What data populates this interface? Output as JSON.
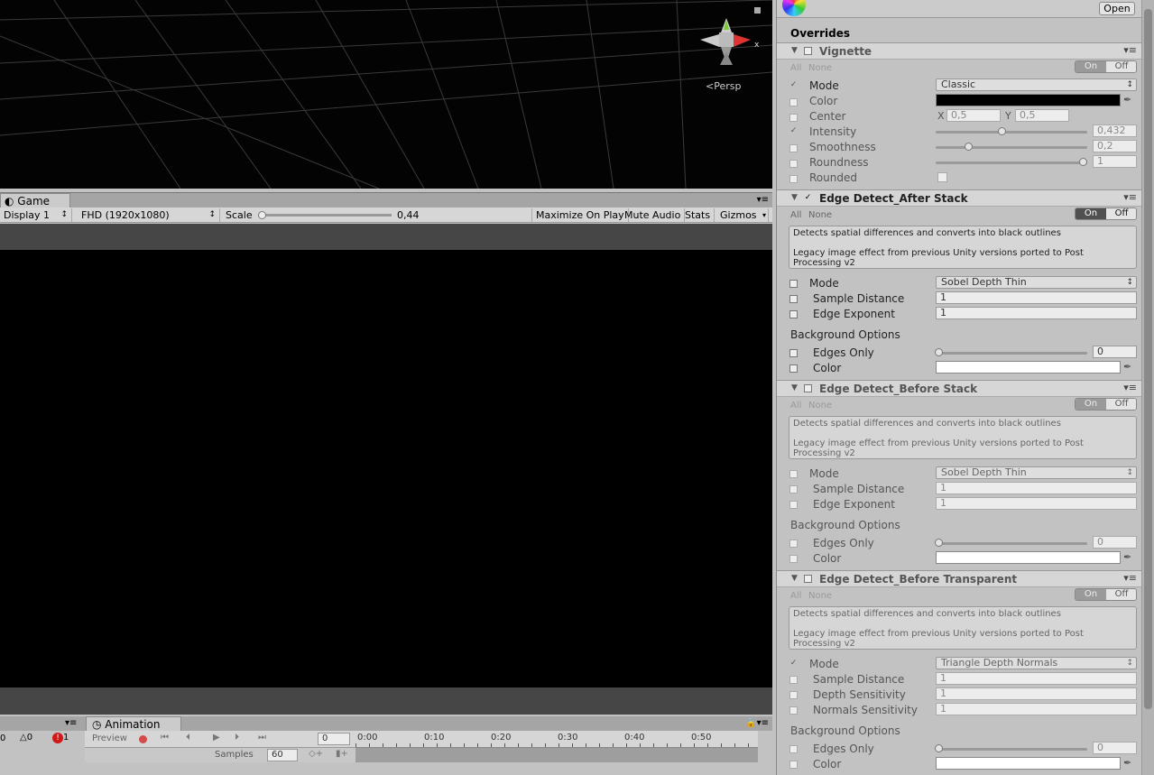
{
  "scene": {
    "persp_label": "Persp",
    "gizmo_axis": "x"
  },
  "game": {
    "tab_label": "Game",
    "display": "Display 1",
    "resolution": "FHD (1920x1080)",
    "scale_label": "Scale",
    "scale_value": "0,44",
    "scale_fraction": 0.0,
    "maximize": "Maximize On Play",
    "mute": "Mute Audio",
    "stats": "Stats",
    "gizmos": "Gizmos"
  },
  "console": {
    "info_count": "0",
    "warn_count": "0",
    "error_count": "1"
  },
  "animation": {
    "tab_label": "Animation",
    "preview": "Preview",
    "frame": "0",
    "samples_label": "Samples",
    "samples": "60",
    "ticks": [
      "0:00",
      "0:10",
      "0:20",
      "0:30",
      "0:40",
      "0:50"
    ]
  },
  "inspector": {
    "open_button": "Open",
    "overrides_title": "Overrides",
    "all": "All",
    "none": "None",
    "on": "On",
    "off": "Off",
    "vignette": {
      "name": "Vignette",
      "mode_label": "Mode",
      "mode_value": "Classic",
      "color_label": "Color",
      "center_label": "Center",
      "center_x_label": "X",
      "center_x": "0,5",
      "center_y_label": "Y",
      "center_y": "0,5",
      "intensity_label": "Intensity",
      "intensity": "0,432",
      "intensity_fraction": 0.432,
      "smoothness_label": "Smoothness",
      "smoothness": "0,2",
      "smoothness_fraction": 0.2,
      "roundness_label": "Roundness",
      "roundness": "1",
      "roundness_fraction": 1.0,
      "rounded_label": "Rounded"
    },
    "after_stack": {
      "name": "Edge Detect_After Stack",
      "desc1": "Detects spatial differences and converts into black outlines",
      "desc2": "Legacy image effect from previous Unity versions ported to Post Processing v2",
      "mode_label": "Mode",
      "mode_value": "Sobel Depth Thin",
      "sample_distance_label": "Sample Distance",
      "sample_distance": "1",
      "edge_exponent_label": "Edge Exponent",
      "edge_exponent": "1",
      "bg_options": "Background Options",
      "edges_only_label": "Edges Only",
      "edges_only": "0",
      "color_label": "Color"
    },
    "before_stack": {
      "name": "Edge Detect_Before Stack",
      "desc1": "Detects spatial differences and converts into black outlines",
      "desc2": "Legacy image effect from previous Unity versions ported to Post Processing v2",
      "mode_label": "Mode",
      "mode_value": "Sobel Depth Thin",
      "sample_distance_label": "Sample Distance",
      "sample_distance": "1",
      "edge_exponent_label": "Edge Exponent",
      "edge_exponent": "1",
      "bg_options": "Background Options",
      "edges_only_label": "Edges Only",
      "edges_only": "0",
      "color_label": "Color"
    },
    "before_transparent": {
      "name": "Edge Detect_Before Transparent",
      "desc1": "Detects spatial differences and converts into black outlines",
      "desc2": "Legacy image effect from previous Unity versions ported to Post Processing v2",
      "mode_label": "Mode",
      "mode_value": "Triangle Depth Normals",
      "sample_distance_label": "Sample Distance",
      "sample_distance": "1",
      "depth_sensitivity_label": "Depth Sensitivity",
      "depth_sensitivity": "1",
      "normals_sensitivity_label": "Normals Sensitivity",
      "normals_sensitivity": "1",
      "bg_options": "Background Options",
      "edges_only_label": "Edges Only",
      "edges_only": "0",
      "color_label": "Color"
    }
  },
  "colors": {
    "panel": "#c2c2c2",
    "scene_bg": "#030303",
    "record": "#d34a4a",
    "error": "#d01818"
  }
}
